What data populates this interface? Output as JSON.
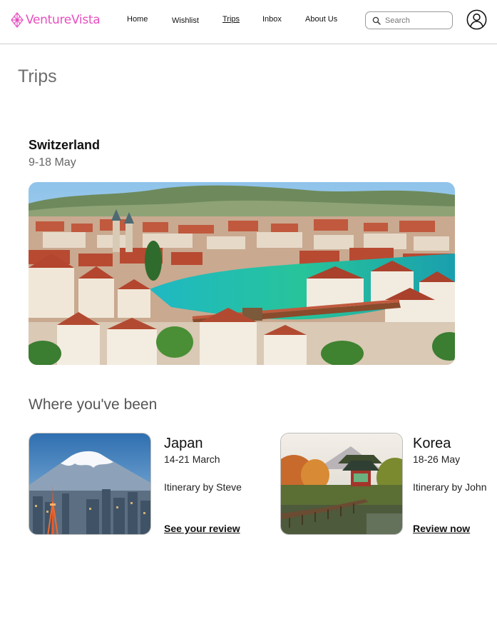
{
  "brand": {
    "name": "VentureVista",
    "color": "#e84fc0"
  },
  "nav": {
    "home": "Home",
    "wishlist": "Wishlist",
    "trips": "Trips",
    "inbox": "Inbox",
    "about": "About Us",
    "active": "Trips"
  },
  "search": {
    "placeholder": "Search",
    "value": "",
    "icon": "search-icon"
  },
  "account": {
    "icon": "user-avatar-icon"
  },
  "page": {
    "title": "Trips"
  },
  "upcoming": {
    "destination": "Switzerland",
    "dates": "9-18 May",
    "image": "lucerne-city-river-bridge"
  },
  "past": {
    "title": "Where you've been",
    "trips": [
      {
        "destination": "Japan",
        "dates": "14-21 March",
        "itinerary": "Itinerary by Steve",
        "link": "See your review",
        "image": "mount-fuji-tokyo-tower"
      },
      {
        "destination": "Korea",
        "dates": "18-26 May",
        "itinerary": "Itinerary by John",
        "link": "Review now",
        "image": "pavilion-on-lake-autumn"
      }
    ]
  }
}
